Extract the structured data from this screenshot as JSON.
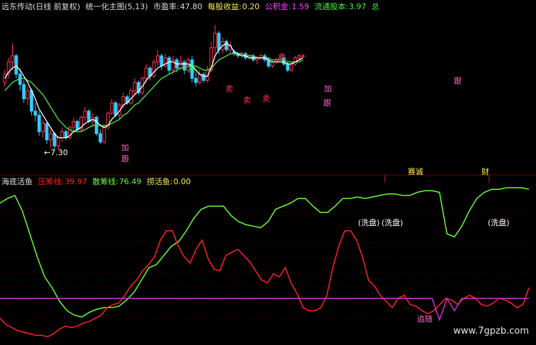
{
  "header_top": {
    "title": "远东传动(日线 前复权)",
    "indicator": "统一化主图(5,13)",
    "pe_label": "市盈率:",
    "pe_value": "47.80",
    "eps_label": "每股收益:",
    "eps_value": "0.20",
    "reserve_label": "公积金:",
    "reserve_value": "1.59",
    "float_label": "流通股本:",
    "float_value": "3.97",
    "extra": "总"
  },
  "header_bottom": {
    "name": "海底活鱼",
    "pressure_label": "压筹线:",
    "pressure_value": "39.97",
    "scatter_label": "散筹线:",
    "scatter_value": "76.49",
    "fish_label": "捞活鱼:",
    "fish_value": "0.00"
  },
  "colors": {
    "bg": "#000000",
    "up": "#ff3355",
    "down": "#33ccff",
    "ma_white": "#ffffff",
    "ma_green": "#44ee44",
    "line_green": "#66ff33",
    "line_red": "#ff2222",
    "magenta": "#cc33cc",
    "pink_text": "#ff66cc",
    "grid": "#7a0000",
    "yellow": "#ffee55"
  },
  "top_annotations": [
    {
      "text": "卖",
      "color": "#44ee44"
    },
    {
      "text": "卖",
      "color": "#ff3355"
    },
    {
      "text": "卖",
      "color": "#ff3355"
    },
    {
      "text": "卖",
      "color": "#ff3355"
    },
    {
      "text": "卖",
      "color": "#ff3355"
    },
    {
      "text": "加",
      "color": "#ff66cc"
    },
    {
      "text": "跟",
      "color": "#ff66cc"
    },
    {
      "text": "加",
      "color": "#ff66cc"
    },
    {
      "text": "跟",
      "color": "#ff66cc"
    },
    {
      "text": "跟",
      "color": "#ff66cc"
    },
    {
      "text": "←7.30",
      "color": "#ffffff"
    }
  ],
  "bottom_annotations": [
    {
      "text": "(洗盘)",
      "color": "#ffffff"
    },
    {
      "text": "(洗盘)",
      "color": "#ffffff"
    },
    {
      "text": "(洗盘)",
      "color": "#ffffff"
    },
    {
      "text": "赛诚",
      "color": "#ffee55"
    },
    {
      "text": "财",
      "color": "#ffee55"
    },
    {
      "text": "追随",
      "color": "#ff66cc"
    }
  ],
  "watermark": "www.7gpzb.com",
  "chart_data": [
    {
      "type": "candlestick",
      "name": "统一化主图(5,13)",
      "price_marker": 7.3,
      "candles": [
        [
          10.6,
          11.2,
          10.4,
          11.0
        ],
        [
          11.0,
          11.8,
          10.8,
          11.6
        ],
        [
          11.6,
          12.5,
          11.2,
          11.9
        ],
        [
          11.9,
          12.0,
          10.8,
          11.0
        ],
        [
          11.0,
          11.3,
          10.2,
          10.5
        ],
        [
          10.5,
          10.7,
          9.6,
          9.8
        ],
        [
          9.8,
          10.4,
          9.5,
          10.2
        ],
        [
          10.2,
          10.3,
          9.0,
          9.2
        ],
        [
          9.2,
          9.6,
          8.7,
          9.0
        ],
        [
          9.0,
          9.2,
          8.0,
          8.2
        ],
        [
          8.2,
          8.8,
          7.9,
          8.6
        ],
        [
          8.6,
          8.7,
          7.6,
          7.8
        ],
        [
          7.8,
          8.3,
          7.4,
          8.1
        ],
        [
          8.1,
          8.2,
          7.3,
          7.5
        ],
        [
          7.5,
          8.0,
          7.3,
          7.9
        ],
        [
          7.9,
          8.4,
          7.7,
          8.2
        ],
        [
          8.2,
          8.3,
          7.8,
          7.9
        ],
        [
          7.9,
          8.5,
          7.8,
          8.4
        ],
        [
          8.4,
          8.9,
          8.2,
          8.7
        ],
        [
          8.7,
          8.8,
          8.2,
          8.3
        ],
        [
          8.3,
          9.0,
          8.2,
          8.9
        ],
        [
          8.9,
          9.4,
          8.7,
          9.2
        ],
        [
          9.2,
          9.3,
          8.6,
          8.7
        ],
        [
          8.7,
          9.1,
          8.4,
          8.9
        ],
        [
          8.9,
          9.0,
          8.0,
          8.1
        ],
        [
          8.1,
          8.3,
          7.6,
          7.7
        ],
        [
          7.7,
          8.5,
          7.6,
          8.4
        ],
        [
          8.4,
          9.2,
          8.3,
          9.1
        ],
        [
          9.1,
          9.8,
          9.0,
          9.6
        ],
        [
          9.6,
          9.7,
          8.9,
          9.0
        ],
        [
          9.0,
          9.6,
          8.8,
          9.5
        ],
        [
          9.5,
          10.1,
          9.3,
          9.9
        ],
        [
          9.9,
          10.0,
          9.5,
          9.6
        ],
        [
          9.6,
          10.3,
          9.5,
          10.2
        ],
        [
          10.2,
          10.8,
          10.0,
          10.6
        ],
        [
          10.6,
          10.7,
          10.0,
          10.1
        ],
        [
          10.1,
          10.9,
          10.0,
          10.8
        ],
        [
          10.8,
          11.5,
          10.6,
          11.3
        ],
        [
          11.3,
          11.4,
          10.7,
          10.9
        ],
        [
          10.9,
          11.7,
          10.8,
          11.6
        ],
        [
          11.6,
          12.2,
          11.4,
          11.9
        ],
        [
          11.9,
          12.0,
          11.2,
          11.4
        ],
        [
          11.4,
          12.0,
          11.3,
          11.8
        ],
        [
          11.8,
          11.9,
          11.0,
          11.2
        ],
        [
          11.2,
          11.9,
          11.0,
          11.7
        ],
        [
          11.7,
          11.8,
          11.1,
          11.3
        ],
        [
          11.3,
          11.9,
          11.2,
          11.6
        ],
        [
          11.6,
          11.7,
          11.0,
          11.2
        ],
        [
          11.2,
          11.8,
          11.1,
          11.7
        ],
        [
          11.7,
          11.9,
          10.6,
          10.8
        ],
        [
          10.8,
          11.1,
          10.4,
          10.6
        ],
        [
          10.6,
          11.2,
          10.5,
          11.0
        ],
        [
          11.0,
          11.1,
          10.6,
          10.7
        ],
        [
          10.7,
          11.4,
          10.6,
          11.2
        ],
        [
          11.2,
          12.6,
          11.1,
          12.3
        ],
        [
          12.3,
          13.4,
          12.0,
          13.0
        ],
        [
          13.0,
          13.1,
          12.0,
          12.2
        ],
        [
          12.2,
          12.8,
          12.0,
          12.6
        ],
        [
          12.6,
          12.7,
          12.1,
          12.2
        ],
        [
          12.2,
          12.6,
          12.0,
          12.4
        ],
        [
          12.1,
          12.2,
          11.9,
          12.0
        ],
        [
          12.0,
          12.1,
          11.8,
          11.9
        ],
        [
          11.9,
          12.1,
          11.8,
          12.0
        ],
        [
          12.0,
          12.1,
          11.7,
          11.8
        ],
        [
          11.8,
          12.0,
          11.7,
          11.9
        ],
        [
          11.9,
          12.0,
          11.6,
          11.7
        ],
        [
          11.7,
          11.9,
          11.5,
          11.8
        ],
        [
          11.8,
          12.0,
          11.7,
          11.9
        ],
        [
          11.9,
          12.0,
          11.6,
          11.7
        ],
        [
          11.7,
          11.8,
          11.3,
          11.4
        ],
        [
          11.4,
          11.7,
          11.3,
          11.6
        ],
        [
          11.6,
          11.8,
          11.5,
          11.7
        ],
        [
          11.7,
          11.9,
          11.6,
          11.8
        ],
        [
          11.8,
          11.9,
          11.4,
          11.5
        ],
        [
          11.5,
          11.6,
          11.1,
          11.2
        ],
        [
          11.2,
          11.6,
          11.1,
          11.5
        ],
        [
          11.5,
          11.9,
          11.4,
          11.8
        ],
        [
          11.8,
          12.0,
          11.7,
          11.9
        ],
        [
          11.9,
          12.0,
          11.8,
          11.9
        ]
      ],
      "ma_short": [
        10.8,
        11.1,
        11.3,
        11.4,
        11.2,
        10.9,
        10.6,
        10.2,
        9.8,
        9.3,
        9.0,
        8.7,
        8.4,
        8.1,
        7.9,
        7.9,
        7.9,
        8.0,
        8.2,
        8.3,
        8.4,
        8.6,
        8.7,
        8.8,
        8.7,
        8.5,
        8.4,
        8.5,
        8.8,
        9.0,
        9.2,
        9.5,
        9.6,
        9.8,
        10.0,
        10.2,
        10.4,
        10.7,
        10.9,
        11.1,
        11.3,
        11.4,
        11.5,
        11.6,
        11.6,
        11.5,
        11.5,
        11.5,
        11.5,
        11.4,
        11.2,
        11.0,
        10.9,
        10.9,
        11.3,
        11.9,
        12.2,
        12.4,
        12.5,
        12.4,
        12.1,
        12.0,
        11.9,
        11.9,
        11.8,
        11.8,
        11.8,
        11.8,
        11.8,
        11.7,
        11.6,
        11.6,
        11.6,
        11.6,
        11.5,
        11.5,
        11.6,
        11.7,
        11.8
      ],
      "ma_long": [
        10.2,
        10.4,
        10.6,
        10.7,
        10.8,
        10.8,
        10.7,
        10.6,
        10.4,
        10.2,
        10.0,
        9.7,
        9.4,
        9.1,
        8.8,
        8.6,
        8.4,
        8.3,
        8.2,
        8.2,
        8.2,
        8.3,
        8.4,
        8.5,
        8.5,
        8.5,
        8.5,
        8.5,
        8.6,
        8.7,
        8.8,
        9.0,
        9.1,
        9.3,
        9.5,
        9.6,
        9.8,
        10.0,
        10.2,
        10.4,
        10.6,
        10.8,
        10.9,
        11.0,
        11.1,
        11.2,
        11.3,
        11.3,
        11.4,
        11.4,
        11.4,
        11.3,
        11.2,
        11.2,
        11.3,
        11.5,
        11.7,
        11.8,
        11.9,
        12.0,
        12.0,
        12.0,
        12.0,
        11.9,
        11.9,
        11.9,
        11.8,
        11.8,
        11.8,
        11.8,
        11.7,
        11.7,
        11.7,
        11.7,
        11.6,
        11.6,
        11.6,
        11.6,
        11.7
      ]
    },
    {
      "type": "line",
      "name": "海底活鱼",
      "ylim": [
        0,
        100
      ],
      "reference_line": 28,
      "series": [
        {
          "name": "散筹线",
          "color": "#66ff33",
          "values": [
            90,
            93,
            95,
            85,
            70,
            55,
            42,
            35,
            26,
            20,
            17,
            16,
            19,
            21,
            22,
            22,
            23,
            27,
            32,
            40,
            48,
            50,
            56,
            62,
            65,
            72,
            80,
            86,
            88,
            88,
            88,
            82,
            78,
            76,
            75,
            74,
            78,
            86,
            88,
            90,
            93,
            93,
            88,
            84,
            84,
            88,
            93,
            93,
            94,
            93,
            94,
            95,
            96,
            96,
            95,
            95,
            97,
            98,
            98,
            97,
            70,
            68,
            75,
            85,
            93,
            97,
            99,
            99,
            100,
            100,
            100,
            99
          ]
        },
        {
          "name": "压筹线",
          "color": "#ff2222",
          "values": [
            15,
            11,
            9,
            7,
            6,
            5,
            4,
            4,
            3,
            5,
            8,
            10,
            9,
            10,
            12,
            13,
            15,
            17,
            22,
            24,
            25,
            30,
            36,
            40,
            46,
            50,
            55,
            66,
            72,
            72,
            62,
            55,
            51,
            60,
            66,
            54,
            47,
            46,
            56,
            58,
            60,
            56,
            52,
            46,
            40,
            38,
            44,
            42,
            48,
            38,
            31,
            22,
            20,
            20,
            22,
            30,
            48,
            62,
            72,
            72,
            66,
            55,
            40,
            36,
            30,
            26,
            22,
            28,
            30,
            24,
            23,
            20,
            18,
            20,
            24,
            28,
            27,
            24,
            28,
            30,
            28,
            24,
            23,
            25,
            28,
            27,
            25,
            22,
            24,
            35
          ]
        },
        {
          "name": "捞活鱼",
          "color": "#cc33cc",
          "values": [
            28,
            28,
            28,
            28,
            28,
            28,
            28,
            28,
            28,
            28,
            28,
            28,
            28,
            28,
            28,
            28,
            28,
            28,
            28,
            28,
            28,
            28,
            28,
            28,
            28,
            28,
            28,
            28,
            28,
            28,
            28,
            28,
            28,
            28,
            28,
            28,
            28,
            28,
            28,
            28,
            28,
            28,
            28,
            28,
            28,
            28,
            28,
            28,
            28,
            28,
            28,
            28,
            28,
            28,
            28,
            28,
            28,
            28,
            28,
            14,
            28,
            20,
            28,
            28,
            28,
            28,
            28,
            28,
            28,
            28,
            28,
            28
          ]
        }
      ]
    }
  ]
}
